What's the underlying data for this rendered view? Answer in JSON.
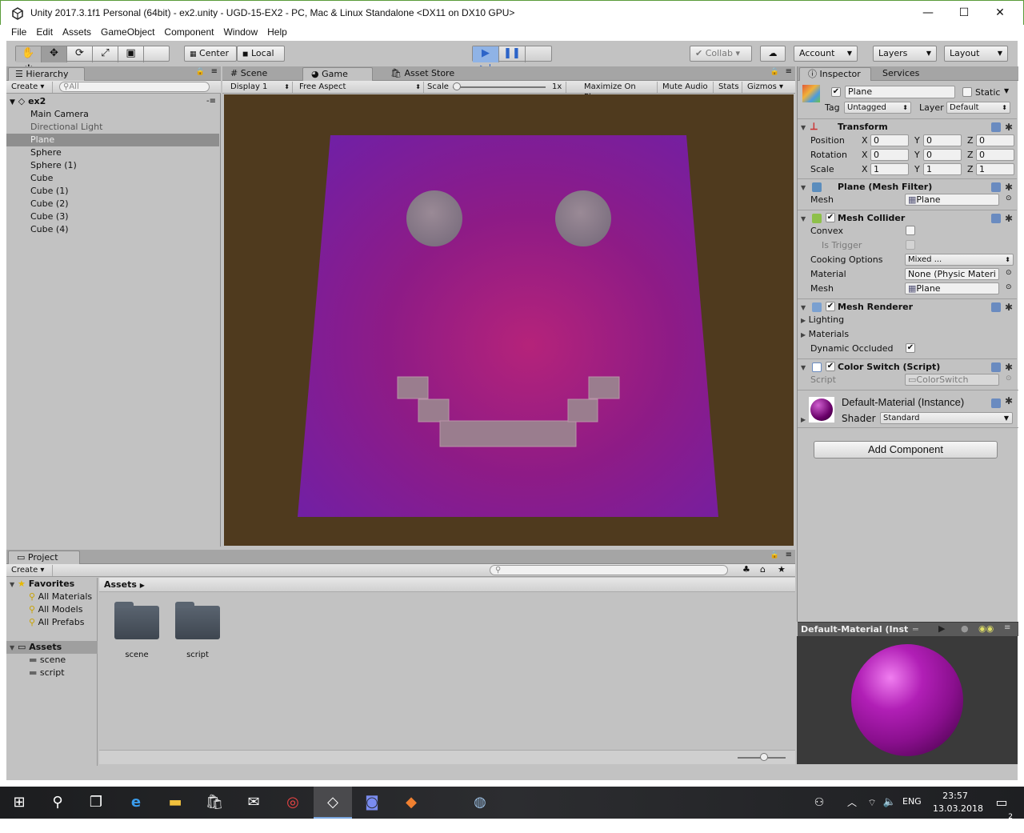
{
  "window": {
    "title": "Unity 2017.3.1f1 Personal (64bit) - ex2.unity - UGD-15-EX2 - PC, Mac & Linux Standalone <DX11 on DX10 GPU>",
    "minimize": "—",
    "maximize": "☐",
    "close": "✕"
  },
  "menu": [
    "File",
    "Edit",
    "Assets",
    "GameObject",
    "Component",
    "Window",
    "Help"
  ],
  "toolbar": {
    "tools": [
      "hand-icon",
      "move-icon",
      "rotate-icon",
      "scale-icon",
      "rect-icon",
      "transform-icon"
    ],
    "pivot": "Center",
    "space": "Local",
    "collab": "Collab ▾",
    "account": "Account",
    "layers": "Layers",
    "layout": "Layout"
  },
  "hierarchy": {
    "tab": "Hierarchy",
    "create": "Create",
    "search_placeholder": "All",
    "scene": "ex2",
    "items": [
      "Main Camera",
      "Directional Light",
      "Plane",
      "Sphere",
      "Sphere (1)",
      "Cube",
      "Cube (1)",
      "Cube (2)",
      "Cube (3)",
      "Cube (4)"
    ],
    "selected": "Plane"
  },
  "center": {
    "tabs": [
      "Scene",
      "Game",
      "Asset Store"
    ],
    "active_tab": "Game",
    "display": "Display 1",
    "aspect": "Free Aspect",
    "scale_label": "Scale",
    "scale_value": "1x",
    "maximize": "Maximize On Play",
    "mute": "Mute Audio",
    "stats": "Stats",
    "gizmos": "Gizmos"
  },
  "inspector": {
    "tabs": [
      "Inspector",
      "Services"
    ],
    "object_name": "Plane",
    "static_label": "Static",
    "tag_label": "Tag",
    "tag_value": "Untagged",
    "layer_label": "Layer",
    "layer_value": "Default",
    "transform": {
      "title": "Transform",
      "rows": [
        {
          "label": "Position",
          "x": "0",
          "y": "0",
          "z": "0"
        },
        {
          "label": "Rotation",
          "x": "0",
          "y": "0",
          "z": "0"
        },
        {
          "label": "Scale",
          "x": "1",
          "y": "1",
          "z": "1"
        }
      ]
    },
    "mesh_filter": {
      "title": "Plane (Mesh Filter)",
      "mesh_label": "Mesh",
      "mesh_value": "Plane"
    },
    "mesh_collider": {
      "title": "Mesh Collider",
      "convex": "Convex",
      "is_trigger": "Is Trigger",
      "cooking": "Cooking Options",
      "cooking_value": "Mixed ...",
      "material": "Material",
      "material_value": "None (Physic Materi",
      "mesh": "Mesh",
      "mesh_value": "Plane"
    },
    "mesh_renderer": {
      "title": "Mesh Renderer",
      "lighting": "Lighting",
      "materials": "Materials",
      "dynamic_occluded": "Dynamic Occluded"
    },
    "color_switch": {
      "title": "Color Switch (Script)",
      "script_label": "Script",
      "script_value": "ColorSwitch"
    },
    "material": {
      "name": "Default-Material (Instance)",
      "shader_label": "Shader",
      "shader_value": "Standard"
    },
    "add_component": "Add Component",
    "preview_title": "Default-Material (Inst"
  },
  "project": {
    "tab": "Project",
    "create": "Create",
    "favorites": "Favorites",
    "favorite_items": [
      "All Materials",
      "All Models",
      "All Prefabs"
    ],
    "assets": "Assets",
    "asset_folders": [
      "scene",
      "script"
    ],
    "breadcrumb": "Assets"
  },
  "taskbar": {
    "time": "23:57",
    "date": "13.03.2018",
    "lang": "ENG",
    "notifications": "2"
  },
  "colors": {
    "accent": "#3d7bd6",
    "plane": "#8a1f8f",
    "game_bg": "#4f3a1e"
  }
}
